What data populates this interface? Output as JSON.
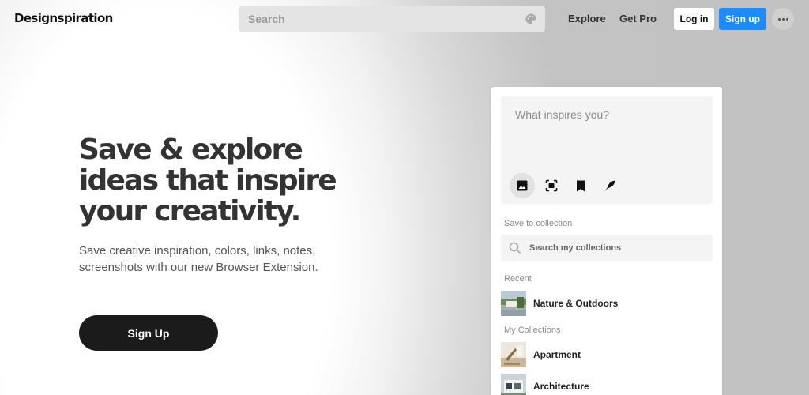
{
  "header": {
    "logo": "Designspiration",
    "search": {
      "placeholder": "Search"
    },
    "nav": {
      "explore": "Explore",
      "get_pro": "Get Pro"
    },
    "login_label": "Log in",
    "signup_label": "Sign up"
  },
  "hero": {
    "title_lines": [
      "Save & explore",
      "ideas that inspire",
      "your creativity."
    ],
    "subtitle": "Save creative inspiration, colors, links, notes, screenshots with our new Browser Extension.",
    "cta_label": "Sign Up"
  },
  "panel": {
    "compose_placeholder": "What inspires you?",
    "tools": [
      "image-icon",
      "screenshot-icon",
      "bookmark-icon",
      "feather-icon"
    ],
    "save_to_collection_label": "Save to collection",
    "collection_search_placeholder": "Search my collections",
    "recent_label": "Recent",
    "recent": [
      {
        "name": "Nature & Outdoors"
      }
    ],
    "my_collections_label": "My Collections",
    "collections": [
      {
        "name": "Apartment"
      },
      {
        "name": "Architecture"
      }
    ]
  },
  "colors": {
    "accent": "#1a8cff",
    "cta": "#1b1b1b",
    "headline": "#333333"
  }
}
